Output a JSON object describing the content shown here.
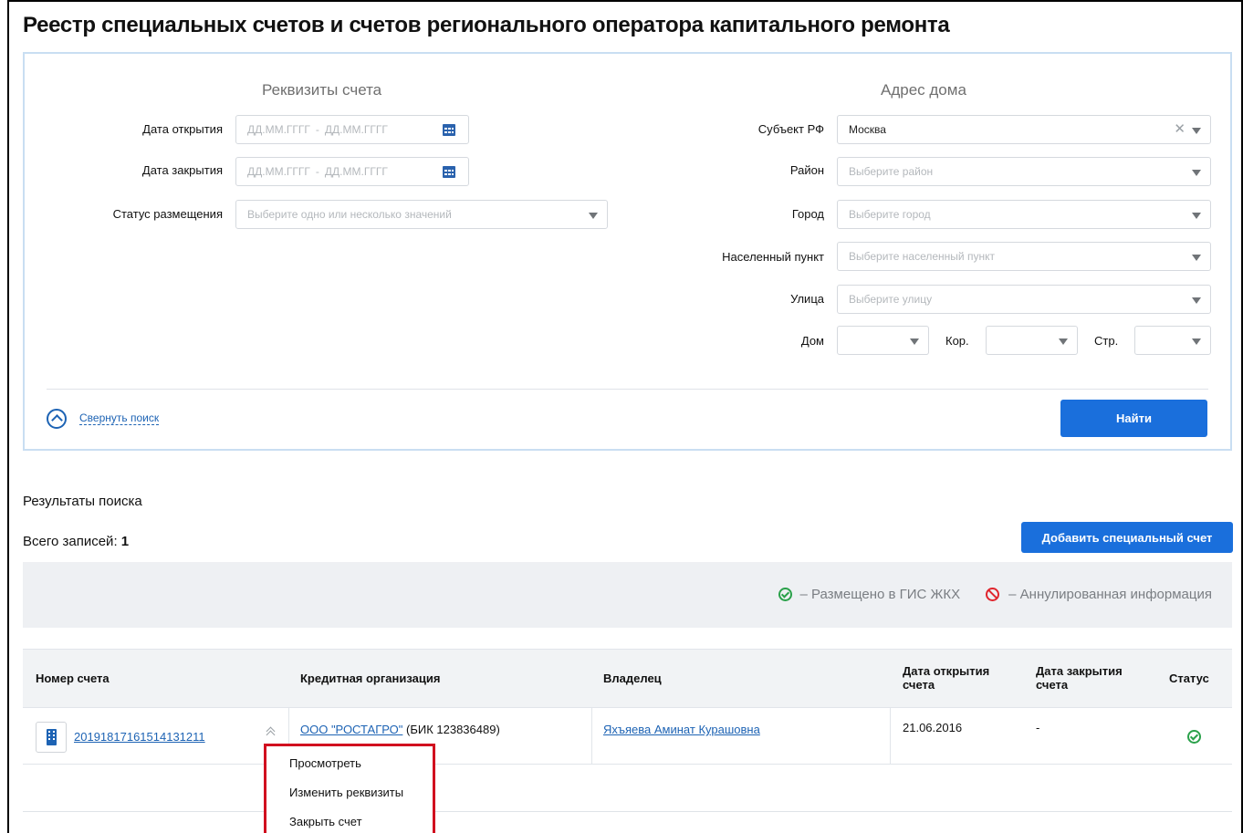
{
  "page": {
    "title": "Реестр специальных счетов и счетов регионального оператора капитального ремонта"
  },
  "search": {
    "account_section_title": "Реквизиты счета",
    "address_section_title": "Адрес дома",
    "open_date": {
      "label": "Дата открытия",
      "from_placeholder": "ДД.ММ.ГГГГ",
      "to_placeholder": "ДД.ММ.ГГГГ",
      "separator": "-"
    },
    "close_date": {
      "label": "Дата закрытия",
      "from_placeholder": "ДД.ММ.ГГГГ",
      "to_placeholder": "ДД.ММ.ГГГГ",
      "separator": "-"
    },
    "placement_status": {
      "label": "Статус размещения",
      "placeholder": "Выберите одно или несколько значений"
    },
    "subject": {
      "label": "Субъект РФ",
      "value": "Москва",
      "clear": "✕"
    },
    "district": {
      "label": "Район",
      "placeholder": "Выберите район"
    },
    "city": {
      "label": "Город",
      "placeholder": "Выберите город"
    },
    "settlement": {
      "label": "Населенный пункт",
      "placeholder": "Выберите населенный пункт"
    },
    "street": {
      "label": "Улица",
      "placeholder": "Выберите улицу"
    },
    "house": {
      "label": "Дом"
    },
    "building": {
      "label": "Кор."
    },
    "structure": {
      "label": "Стр."
    },
    "collapse_label": "Свернуть поиск",
    "find_button": "Найти"
  },
  "results": {
    "title": "Результаты поиска",
    "total_label": "Всего записей:",
    "total_value": "1",
    "add_button": "Добавить специальный счет",
    "legend": {
      "placed": "– Размещено в ГИС ЖКХ",
      "annulled": "– Аннулированная информация"
    },
    "table": {
      "columns": [
        {
          "key": "number",
          "label": "Номер счета",
          "width": 0.219
        },
        {
          "key": "bank",
          "label": "Кредитная организация",
          "width": 0.251
        },
        {
          "key": "owner",
          "label": "Владелец",
          "width": 0.24
        },
        {
          "key": "open_date",
          "label": "Дата открытия счета",
          "width": 0.117
        },
        {
          "key": "close_date",
          "label": "Дата закрытия счета",
          "width": 0.111
        },
        {
          "key": "status",
          "label": "Статус",
          "width": 0.062
        }
      ],
      "rows": [
        {
          "number": "20191817161514131211",
          "bank_name": "ООО \"РОСТАГРО\"",
          "bank_bik": "(БИК 123836489)",
          "owner": "Яхъяева Аминат Курашовна",
          "open_date": "21.06.2016",
          "close_date": "-",
          "status": "placed"
        }
      ]
    }
  },
  "context_menu": {
    "items": [
      "Просмотреть",
      "Изменить реквизиты",
      "Закрыть счет"
    ]
  },
  "colors": {
    "accent": "#1a6fdc",
    "link": "#1d63b4",
    "success": "#2aa14a",
    "danger": "#e0252d",
    "highlight": "#d1101f"
  }
}
